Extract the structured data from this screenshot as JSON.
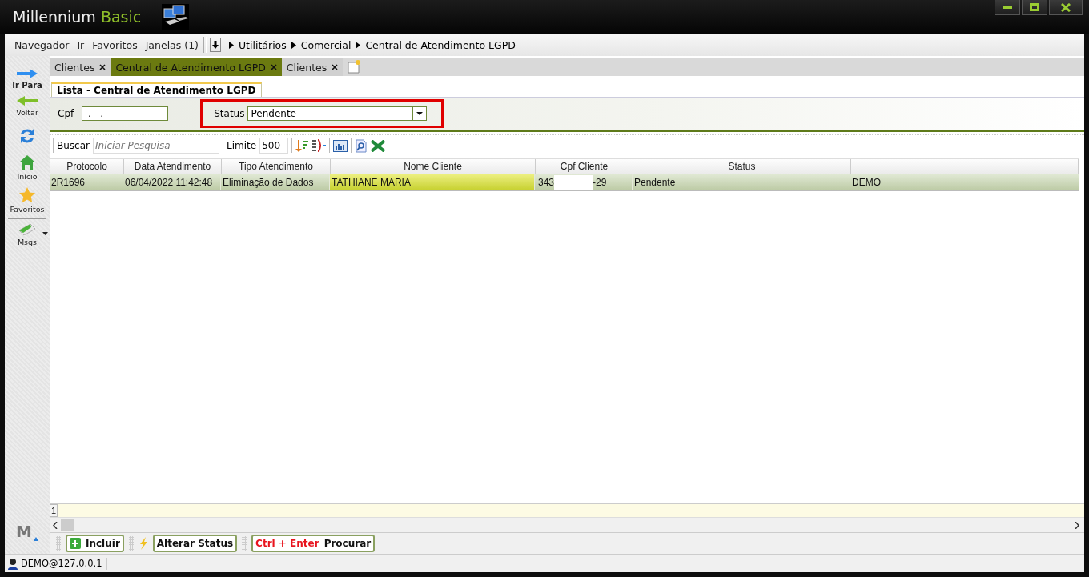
{
  "window": {
    "title_main": "Millennium",
    "title_accent": "Basic"
  },
  "menu": {
    "items": [
      "Navegador",
      "Ir",
      "Favoritos",
      "Janelas (1)"
    ],
    "breadcrumb": [
      "Utilitários",
      "Comercial",
      "Central de Atendimento LGPD"
    ]
  },
  "sidebar": {
    "items": [
      {
        "kind": "forward",
        "label": "Ir Para"
      },
      {
        "kind": "back",
        "label": "Voltar"
      },
      {
        "kind": "refresh"
      },
      {
        "kind": "home",
        "label": "Início"
      },
      {
        "kind": "star",
        "label": "Favoritos"
      },
      {
        "kind": "mail",
        "label": "Msgs"
      }
    ],
    "logo": "M"
  },
  "tabs": [
    {
      "label": "Clientes",
      "selected": false
    },
    {
      "label": "Central de Atendimento LGPD",
      "selected": true
    },
    {
      "label": "Clientes",
      "selected": false
    }
  ],
  "subtab": {
    "label": "Lista - Central de Atendimento LGPD"
  },
  "filters": {
    "cpf": {
      "label": "Cpf",
      "value": " .   .   -"
    },
    "status": {
      "label": "Status",
      "value": "Pendente",
      "highlighted": true
    }
  },
  "toolbar": {
    "search_label": "Buscar",
    "search_placeholder": "Iniciar Pesquisa",
    "limit_label": "Limite",
    "limit_value": "500"
  },
  "table": {
    "columns": [
      "Protocolo",
      "Data Atendimento",
      "Tipo Atendimento",
      "Nome Cliente",
      "Cpf Cliente",
      "Status",
      ""
    ],
    "rows": [
      {
        "selected": true,
        "protocolo": "2R1696",
        "data": "06/04/2022 11:42:48",
        "tipo": "Eliminação de Dados",
        "nome": "TATHIANE MARIA",
        "cpf_start": "343",
        "cpf_end": "-29",
        "status": "Pendente",
        "column_7": "DEMO"
      }
    ]
  },
  "pager": {
    "page": "1"
  },
  "actions": [
    {
      "kind": "add",
      "label": "Incluir"
    },
    {
      "kind": "bolt"
    },
    {
      "kind": "plain",
      "label": "Alterar Status"
    },
    {
      "kind": "shortcut",
      "shortcut": "Ctrl + Enter",
      "label": "Procurar"
    }
  ],
  "status_bar": {
    "user": "DEMO@127.0.0.1"
  }
}
